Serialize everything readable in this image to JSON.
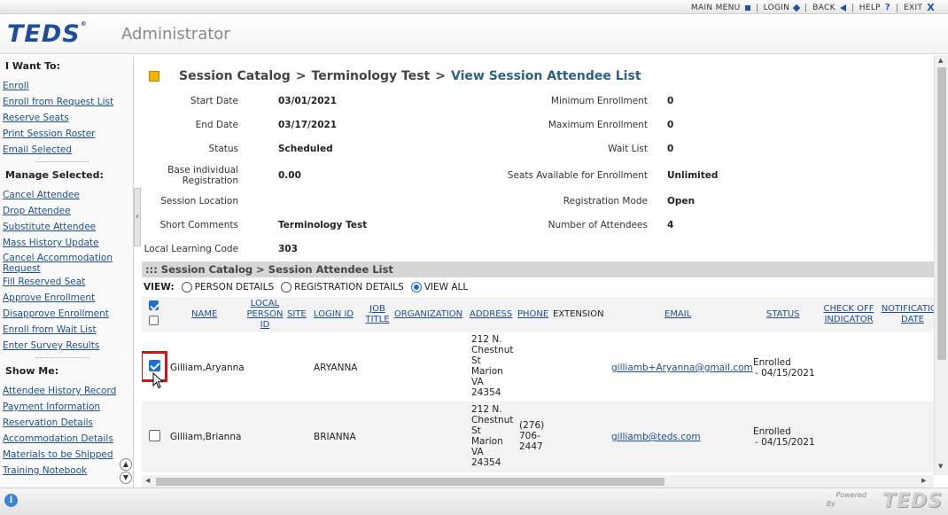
{
  "top_menu": [
    {
      "label": "MAIN MENU",
      "icon": "square-icon"
    },
    {
      "label": "LOGIN",
      "icon": "diamond-icon"
    },
    {
      "label": "BACK",
      "icon": "back-arrow-icon"
    },
    {
      "label": "HELP",
      "icon": "help-icon"
    },
    {
      "label": "EXIT",
      "icon": "exit-icon"
    }
  ],
  "header": {
    "logo": "TEDS",
    "logo_mark": "®",
    "subtitle": "Administrator"
  },
  "sidebar": {
    "i_want_to": {
      "heading": "I Want To:",
      "items": [
        "Enroll",
        "Enroll from Request List",
        "Reserve Seats",
        "Print Session Roster",
        "Email Selected"
      ]
    },
    "manage_selected": {
      "heading": "Manage Selected:",
      "items": [
        "Cancel Attendee",
        "Drop Attendee",
        "Substitute Attendee",
        "Mass History Update",
        "Cancel Accommodation Request",
        "Fill Reserved Seat",
        "Approve Enrollment",
        "Disapprove Enrollment",
        "Enroll from Wait List",
        "Enter Survey Results"
      ]
    },
    "show_me": {
      "heading": "Show Me:",
      "items": [
        "Attendee History Record",
        "Payment Information",
        "Reservation Details",
        "Accommodation Details",
        "Materials to be Shipped",
        "Training Notebook"
      ]
    }
  },
  "breadcrumb": {
    "part1": "Session Catalog",
    "sep1": ">",
    "part2": "Terminology Test",
    "sep2": ">",
    "current": "View Session Attendee List"
  },
  "details_left": [
    {
      "label": "Start Date",
      "value": "03/01/2021"
    },
    {
      "label": "End Date",
      "value": "03/17/2021"
    },
    {
      "label": "Status",
      "value": "Scheduled"
    },
    {
      "label": "Base individual Registration",
      "value": "0.00"
    },
    {
      "label": "Session Location",
      "value": ""
    },
    {
      "label": "Short Comments",
      "value": "Terminology Test"
    },
    {
      "label": "Local Learning Code",
      "value": "303"
    }
  ],
  "details_right": [
    {
      "label": "Minimum Enrollment",
      "value": "0"
    },
    {
      "label": "Maximum Enrollment",
      "value": "0"
    },
    {
      "label": "Wait List",
      "value": "0"
    },
    {
      "label": "Seats Available for Enrollment",
      "value": "Unlimited"
    },
    {
      "label": "Registration Mode",
      "value": "Open"
    },
    {
      "label": "Number of Attendees",
      "value": "4"
    }
  ],
  "subbar": "::: Session Catalog > Session Attendee List",
  "view": {
    "label": "VIEW:",
    "options": [
      "PERSON DETAILS",
      "REGISTRATION DETAILS",
      "VIEW ALL"
    ],
    "selected": "VIEW ALL"
  },
  "columns": [
    "NAME",
    "LOCAL PERSON ID",
    "SITE",
    "LOGIN ID",
    "JOB TITLE",
    "ORGANIZATION",
    "ADDRESS",
    "PHONE",
    "EXTENSION",
    "EMAIL",
    "STATUS",
    "CHECK OFF INDICATOR",
    "NOTIFICATION DATE"
  ],
  "rows": [
    {
      "checked": true,
      "name": "Gilliam,Aryanna",
      "login_id": "ARYANNA",
      "address": [
        "212 N.",
        "Chestnut",
        "St",
        "Marion",
        "VA",
        "24354"
      ],
      "phone": [],
      "email": "gilliamb+Aryanna@gmail.com",
      "status": "Enrolled",
      "status_date": "- 04/15/2021"
    },
    {
      "checked": false,
      "name": "Gilliam,Brianna",
      "login_id": "BRIANNA",
      "address": [
        "212 N.",
        "Chestnut",
        "St",
        "Marion",
        "VA",
        "24354"
      ],
      "phone": [
        "(276)",
        "706-",
        "2447"
      ],
      "email": "gilliamb@teds.com",
      "status": "Enrolled",
      "status_date": "- 04/15/2021"
    }
  ],
  "footer": {
    "powered": "Powered",
    "by": "By",
    "logo": "TEDS"
  }
}
